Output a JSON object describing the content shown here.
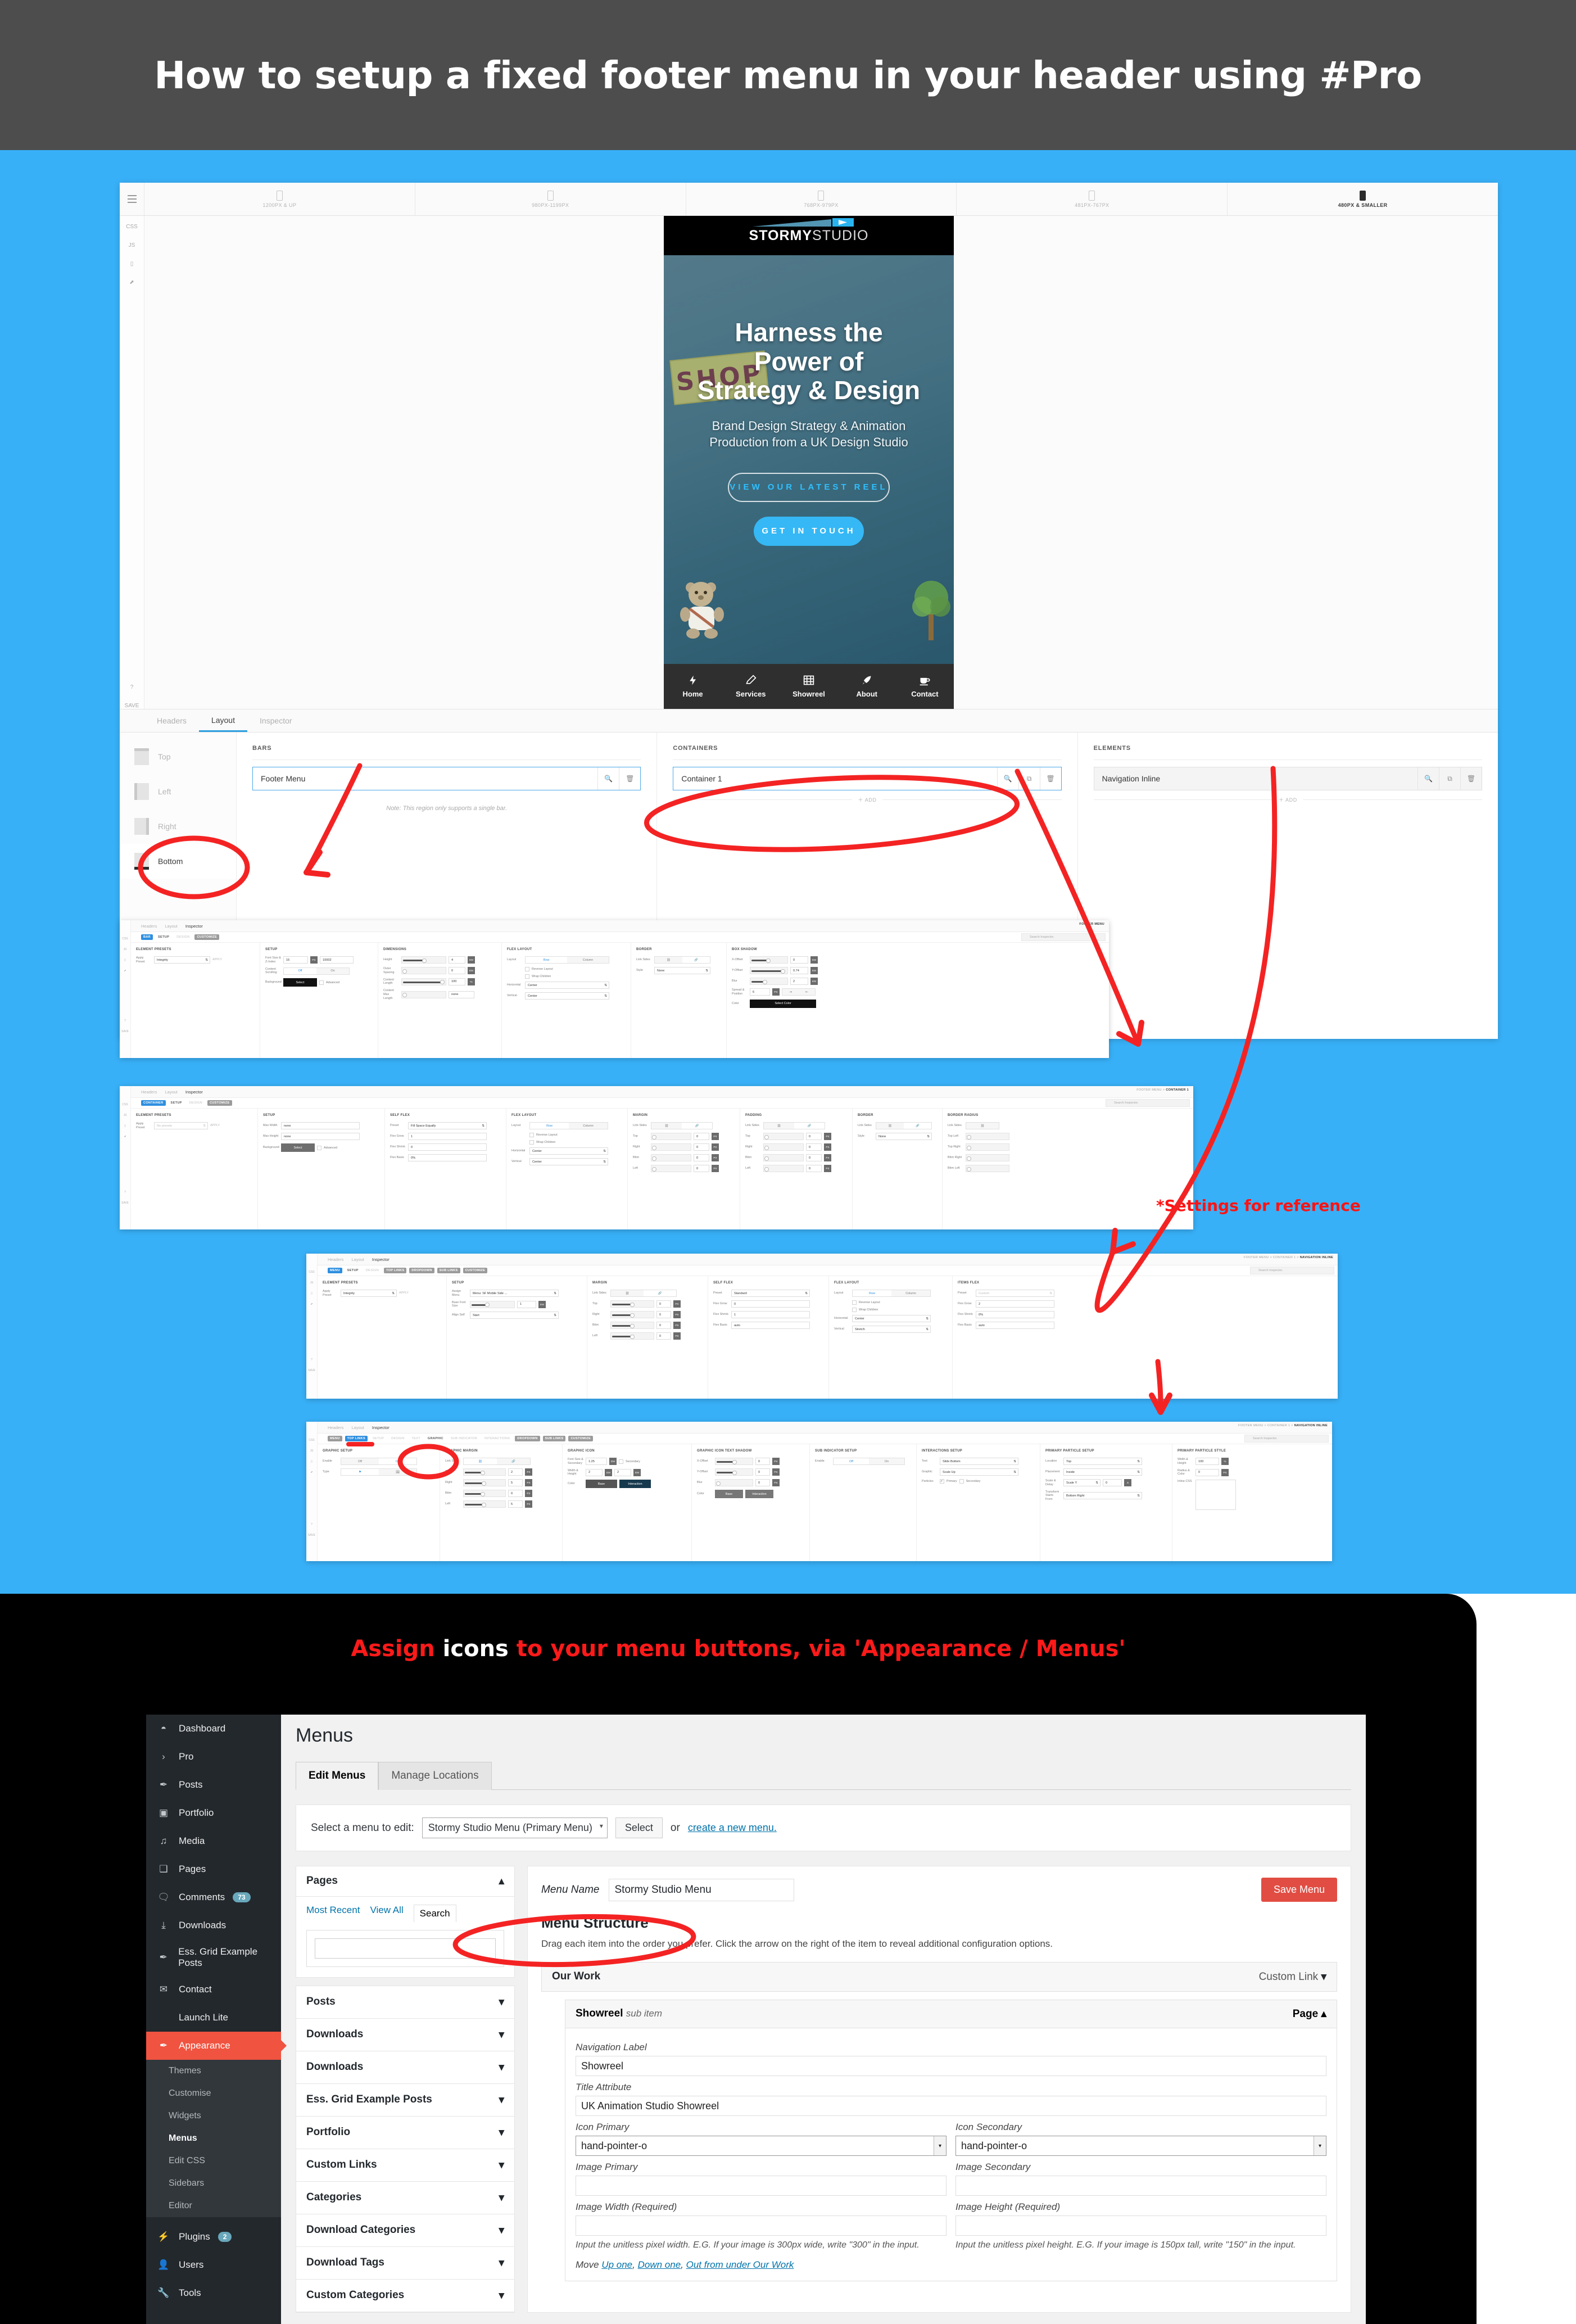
{
  "banner": {
    "title": "How to setup a fixed footer menu in your header using #Pro"
  },
  "editor": {
    "breakpoints": [
      {
        "label": "1200PX & UP",
        "active": false
      },
      {
        "label": "980PX-1199PX",
        "active": false
      },
      {
        "label": "768PX-979PX",
        "active": false
      },
      {
        "label": "481PX-767PX",
        "active": false
      },
      {
        "label": "480PX & SMALLER",
        "active": true
      }
    ],
    "rail": [
      "CSS",
      "JS",
      "device-icon",
      "external-link-icon",
      "help-icon",
      "SAVE"
    ],
    "tabs": [
      {
        "label": "Headers",
        "active": false
      },
      {
        "label": "Layout",
        "active": true
      },
      {
        "label": "Inspector",
        "active": false
      }
    ],
    "regions": [
      {
        "label": "Top",
        "active": false
      },
      {
        "label": "Left",
        "active": false
      },
      {
        "label": "Right",
        "active": false
      },
      {
        "label": "Bottom",
        "active": true
      }
    ],
    "bars": {
      "heading": "BARS",
      "item": "Footer Menu",
      "note": "Note: This region only supports a single bar."
    },
    "containers": {
      "heading": "CONTAINERS",
      "item": "Container 1",
      "add": "＋ ADD"
    },
    "elements": {
      "heading": "ELEMENTS",
      "item": "Navigation Inline",
      "add": "＋ ADD"
    }
  },
  "preview": {
    "logo_bold": "STORMY",
    "logo_light": "STUDIO",
    "shop_sign": "SHOP",
    "headline": "Harness the\nPower of\nStrategy & Design",
    "subhead": "Brand Design Strategy & Animation\nProduction from a UK Design Studio",
    "btn_outline": "VIEW OUR LATEST REEL",
    "btn_solid": "GET IN TOUCH",
    "footer_nav": [
      {
        "label": "Home",
        "icon": "bolt-icon",
        "glyph": "⚡"
      },
      {
        "label": "Services",
        "icon": "pencil-icon",
        "glyph": "✎"
      },
      {
        "label": "Showreel",
        "icon": "film-icon",
        "glyph": "▤"
      },
      {
        "label": "About",
        "icon": "rocket-icon",
        "glyph": "➤"
      },
      {
        "label": "Contact",
        "icon": "coffee-icon",
        "glyph": "☕"
      }
    ]
  },
  "panel_bar": {
    "tabs": [
      "Headers",
      "Layout",
      "Inspector"
    ],
    "active_tab": "Inspector",
    "pills": [
      "BAR",
      "SETUP",
      "DESIGN",
      "CUSTOMIZE"
    ],
    "breadcrumb": "FOOTER MENU",
    "search_placeholder": "Search Inspector.",
    "groups": {
      "presets": {
        "heading": "ELEMENT PRESETS",
        "label": "Apply Preset",
        "value": "Integrity",
        "apply": "APPLY"
      },
      "setup": {
        "heading": "SETUP",
        "font_label": "Font Size & Z-Index",
        "font_size": "16",
        "font_unit": "PX",
        "z_index": "10002",
        "scroll_label": "Content Scrolling",
        "scroll_off": "Off",
        "scroll_on": "On",
        "bg_label": "Background",
        "bg_btn": "Select",
        "bg_adv": "Advanced"
      },
      "dimensions": {
        "heading": "DIMENSIONS",
        "rows": [
          {
            "label": "Height",
            "value": "4",
            "unit": "EM"
          },
          {
            "label": "Outer Spacing",
            "value": "0",
            "unit": "EM"
          },
          {
            "label": "Content Length",
            "value": "100",
            "unit": "%"
          },
          {
            "label": "Content Max Length",
            "value": "none",
            "unit": ""
          }
        ]
      },
      "flex": {
        "heading": "FLEX LAYOUT",
        "layout_label": "Layout",
        "row": "Row",
        "column": "Column",
        "reverse": "Reverse Layout",
        "wrap": "Wrap Children",
        "horizontal_label": "Horizontal",
        "horizontal": "Center",
        "vertical_label": "Vertical",
        "vertical": "Center"
      },
      "border": {
        "heading": "BORDER",
        "link_label": "Link Sides",
        "style_label": "Style",
        "style": "None"
      },
      "shadow": {
        "heading": "BOX SHADOW",
        "rows": [
          {
            "label": "X-Offset",
            "value": "0",
            "unit": "EM"
          },
          {
            "label": "Y-Offset",
            "value": "0.74",
            "unit": "EM"
          },
          {
            "label": "Blur",
            "value": "2",
            "unit": "EM"
          }
        ],
        "spread_label": "Spread & Position",
        "spread": "6",
        "spread_unit": "PX",
        "color_label": "Color",
        "color_btn": "Select Color"
      }
    }
  },
  "panel_container": {
    "pills": [
      "CONTAINER",
      "SETUP",
      "DESIGN",
      "CUSTOMIZE"
    ],
    "breadcrumb_parent": "FOOTER MENU >",
    "breadcrumb_current": "CONTAINER 1",
    "search_placeholder": "Search Inspector.",
    "presets": {
      "heading": "ELEMENT PRESETS",
      "label": "Apply Preset",
      "value": "No presets",
      "apply": "APPLY"
    },
    "setup": {
      "heading": "SETUP",
      "max_width_label": "Max Width",
      "max_width": "none",
      "max_height_label": "Max Height",
      "max_height": "none",
      "bg_label": "Background",
      "bg_btn": "Select",
      "bg_adv": "Advanced"
    },
    "self_flex": {
      "heading": "SELF FLEX",
      "preset_label": "Preset",
      "preset": "Fill Space Equally",
      "grow_label": "Flex Grow",
      "grow": "1",
      "shrink_label": "Flex Shrink",
      "shrink": "0",
      "basis_label": "Flex Basis",
      "basis": "0%"
    },
    "flex": {
      "heading": "FLEX LAYOUT",
      "row": "Row",
      "column": "Column",
      "reverse": "Reverse Layout",
      "wrap": "Wrap Children",
      "horizontal": "Center",
      "vertical": "Center"
    },
    "margin": {
      "heading": "MARGIN",
      "sides": [
        "Top",
        "Right",
        "Bttm",
        "Left"
      ],
      "values": [
        "0",
        "0",
        "0",
        "0"
      ],
      "unit": "PX"
    },
    "padding": {
      "heading": "PADDING",
      "sides": [
        "Top",
        "Right",
        "Bttm",
        "Left"
      ],
      "values": [
        "0",
        "0",
        "0",
        "0"
      ],
      "unit": "PX"
    },
    "border": {
      "heading": "BORDER",
      "style_label": "Style",
      "style": "None"
    },
    "radius": {
      "heading": "BORDER RADIUS",
      "sides": [
        "Top Left",
        "Top Right",
        "Bttm Right",
        "Bttm Left"
      ]
    }
  },
  "panel_menu": {
    "pills": [
      "MENU",
      "SETUP",
      "DESIGN",
      "TOP LINKS",
      "DROPDOWN",
      "SUB LINKS",
      "CUSTOMIZE"
    ],
    "breadcrumb_parent": "FOOTER MENU > CONTAINER 1 >",
    "breadcrumb_current": "NAVIGATION INLINE",
    "search_placeholder": "Search Inspector.",
    "presets": {
      "heading": "ELEMENT PRESETS",
      "label": "Apply Preset",
      "value": "Integrity",
      "apply": "APPLY"
    },
    "setup": {
      "heading": "SETUP",
      "menu_label": "Assign Menu",
      "menu": "Menu: SF Mobile Side ...",
      "font_label": "Base Font Size",
      "font": "1",
      "font_unit": "EM",
      "align_label": "Align Self",
      "align": "Start"
    },
    "margin": {
      "heading": "MARGIN",
      "sides": [
        "Top",
        "Right",
        "Bttm",
        "Left"
      ],
      "values": [
        "0",
        "0",
        "0",
        "0"
      ],
      "unit": "PX"
    },
    "self_flex": {
      "heading": "SELF FLEX",
      "preset_label": "Preset",
      "preset": "Standard",
      "grow_label": "Flex Grow",
      "grow": "0",
      "shrink_label": "Flex Shrink",
      "shrink": "1",
      "basis_label": "Flex Basis",
      "basis": "auto"
    },
    "flex": {
      "heading": "FLEX LAYOUT",
      "row": "Row",
      "column": "Column",
      "reverse": "Reverse Layout",
      "wrap": "Wrap Children",
      "horizontal": "Center",
      "vertical": "Stretch"
    },
    "items_flex": {
      "heading": "ITEMS FLEX",
      "preset_label": "Preset",
      "preset": "Custom",
      "grow_label": "Flex Grow",
      "grow": "2",
      "shrink_label": "Flex Shrink",
      "shrink": "0%",
      "basis_label": "Flex Basis",
      "basis": "auto"
    }
  },
  "panel_toplinks": {
    "pills": [
      "MENU",
      "TOP LINKS",
      "SETUP",
      "DESIGN",
      "TEXT",
      "GRAPHIC",
      "SUB INDICATOR",
      "INTERACTIONS",
      "DROPDOWN",
      "SUB LINKS",
      "CUSTOMIZE"
    ],
    "breadcrumb_parent": "FOOTER MENU > CONTAINER 1 >",
    "breadcrumb_current": "NAVIGATION INLINE",
    "search_placeholder": "Search Inspector.",
    "graphic_setup": {
      "heading": "GRAPHIC SETUP",
      "enable_label": "Enable",
      "off": "Off",
      "on": "On",
      "type_label": "Type"
    },
    "graphic_margin": {
      "heading": "GRAPHIC MARGIN",
      "link_label": "Link Sides",
      "sides": [
        "Top",
        "Right",
        "Bttm",
        "Left"
      ],
      "values": [
        "2",
        "5",
        "0",
        "5"
      ],
      "unit": "PX"
    },
    "graphic_icon": {
      "heading": "GRAPHIC ICON",
      "font_label": "Font Size & Secondary",
      "font": "1.25",
      "font_unit": "EM",
      "secondary": "Secondary",
      "wh_label": "Width & Height",
      "w": "2",
      "h": "2",
      "wh_unit": "EM",
      "color_label": "Color",
      "base": "Base",
      "interaction": "Interaction"
    },
    "icon_shadow": {
      "heading": "GRAPHIC ICON TEXT SHADOW",
      "rows": [
        {
          "label": "X-Offset",
          "value": "0",
          "unit": "PX"
        },
        {
          "label": "Y-Offset",
          "value": "0",
          "unit": "PX"
        },
        {
          "label": "Blur",
          "value": "0",
          "unit": "PX"
        }
      ],
      "color_label": "Color",
      "base": "Base",
      "interaction": "Interaction"
    },
    "sub_indicator": {
      "heading": "SUB INDICATOR SETUP",
      "enable_label": "Enable",
      "off": "Off",
      "on": "On"
    },
    "interactions": {
      "heading": "INTERACTIONS SETUP",
      "text_label": "Text",
      "text": "Slide Bottom",
      "graphic_label": "Graphic",
      "graphic": "Scale Up",
      "particles_label": "Particles",
      "primary": "Primary",
      "secondary": "Secondary"
    },
    "particle_setup": {
      "heading": "PRIMARY PARTICLE SETUP",
      "location_label": "Location",
      "location": "Top",
      "placement_label": "Placement",
      "placement": "Inside",
      "scale_label": "Scale & Delay",
      "scale": "Scale Y",
      "delay": "0",
      "delay_unit": "S",
      "transform_label": "Transform Starts From",
      "transform": "Bottom Right"
    },
    "particle_style": {
      "heading": "PRIMARY PARTICLE STYLE",
      "wh_label": "Width & Height",
      "wh": "100",
      "wh_unit": "%",
      "radius_label": "Radius & Color",
      "radius": "0",
      "radius_unit": "PX",
      "css_label": "Inline CSS"
    }
  },
  "reference_note": "*Settings for reference",
  "wordpress": {
    "heading_red_1": "Assign ",
    "heading_white": "icons",
    "heading_red_2": " to your menu buttons, via 'Appearance / Menus'",
    "page_title": "Menus",
    "sidebar": [
      {
        "label": "Dashboard",
        "icon": "dashboard-icon",
        "glyph": "◓",
        "badge": null,
        "active": false
      },
      {
        "label": "Pro",
        "icon": "chevron-right-icon",
        "glyph": "›",
        "badge": null,
        "active": false
      },
      {
        "label": "Posts",
        "icon": "pin-icon",
        "glyph": "✎",
        "badge": null,
        "active": false
      },
      {
        "label": "Portfolio",
        "icon": "gallery-icon",
        "glyph": "▣",
        "badge": null,
        "active": false
      },
      {
        "label": "Media",
        "icon": "media-icon",
        "glyph": "♫",
        "badge": null,
        "active": false
      },
      {
        "label": "Pages",
        "icon": "pages-icon",
        "glyph": "❑",
        "badge": null,
        "active": false
      },
      {
        "label": "Comments",
        "icon": "comment-icon",
        "glyph": "💬",
        "badge": "73",
        "active": false
      },
      {
        "label": "Downloads",
        "icon": "download-icon",
        "glyph": "⤓",
        "badge": null,
        "active": false
      },
      {
        "label": "Ess. Grid Example Posts",
        "icon": "pin-icon",
        "glyph": "✎",
        "badge": null,
        "active": false
      },
      {
        "label": "Contact",
        "icon": "envelope-icon",
        "glyph": "✉",
        "badge": null,
        "active": false
      },
      {
        "label": "Launch Lite",
        "icon": "blank-icon",
        "glyph": "",
        "badge": null,
        "active": false
      },
      {
        "label": "Appearance",
        "icon": "brush-icon",
        "glyph": "✎",
        "badge": null,
        "active": true
      }
    ],
    "submenu": [
      "Themes",
      "Customise",
      "Widgets",
      "Menus",
      "Edit CSS",
      "Sidebars",
      "Editor"
    ],
    "submenu_current": "Menus",
    "sidebar_bottom": [
      {
        "label": "Plugins",
        "icon": "plug-icon",
        "glyph": "⚡",
        "badge": "2"
      },
      {
        "label": "Users",
        "icon": "user-icon",
        "glyph": "👤",
        "badge": null
      },
      {
        "label": "Tools",
        "icon": "wrench-icon",
        "glyph": "🔧",
        "badge": null
      }
    ],
    "tabs": [
      {
        "label": "Edit Menus",
        "active": true
      },
      {
        "label": "Manage Locations",
        "active": false
      }
    ],
    "select_row": {
      "label": "Select a menu to edit:",
      "value": "Stormy Studio Menu (Primary Menu)",
      "button": "Select",
      "or": "or",
      "link": "create a new menu."
    },
    "pages_box": {
      "heading": "Pages",
      "tabs": [
        "Most Recent",
        "View All",
        "Search"
      ],
      "active_tab": "Search",
      "search_value": ""
    },
    "accordions": [
      "Posts",
      "Downloads",
      "Downloads",
      "Ess. Grid Example Posts",
      "Portfolio",
      "Custom Links",
      "Categories",
      "Download Categories",
      "Download Tags",
      "Custom Categories"
    ],
    "menu_name_label": "Menu Name",
    "menu_name_value": "Stormy Studio Menu",
    "save_button": "Save Menu",
    "structure": {
      "heading": "Menu Structure",
      "description": "Drag each item into the order you prefer. Click the arrow on the right of the item to reveal additional configuration options.",
      "parent_item": {
        "label": "Our Work",
        "type": "Custom Link"
      },
      "child_item": {
        "label": "Showreel",
        "sub": "sub item",
        "type": "Page",
        "nav_label_label": "Navigation Label",
        "nav_label_value": "Showreel",
        "title_attr_label": "Title Attribute",
        "title_attr_value": "UK Animation Studio Showreel",
        "icon_primary_label": "Icon Primary",
        "icon_primary_value": "hand-pointer-o",
        "icon_secondary_label": "Icon Secondary",
        "icon_secondary_value": "hand-pointer-o",
        "image_primary_label": "Image Primary",
        "image_primary_value": "",
        "image_secondary_label": "Image Secondary",
        "image_secondary_value": "",
        "image_width_label": "Image Width (Required)",
        "image_width_value": "",
        "image_height_label": "Image Height (Required)",
        "image_height_value": "",
        "width_hint": "Input the unitless pixel width. E.G. If your image is 300px wide, write \"300\" in the input.",
        "height_hint": "Input the unitless pixel height. E.G. If your image is 150px tall, write \"150\" in the input.",
        "move_label": "Move",
        "move_links": [
          "Up one",
          "Down one",
          "Out from under Our Work"
        ]
      }
    }
  }
}
